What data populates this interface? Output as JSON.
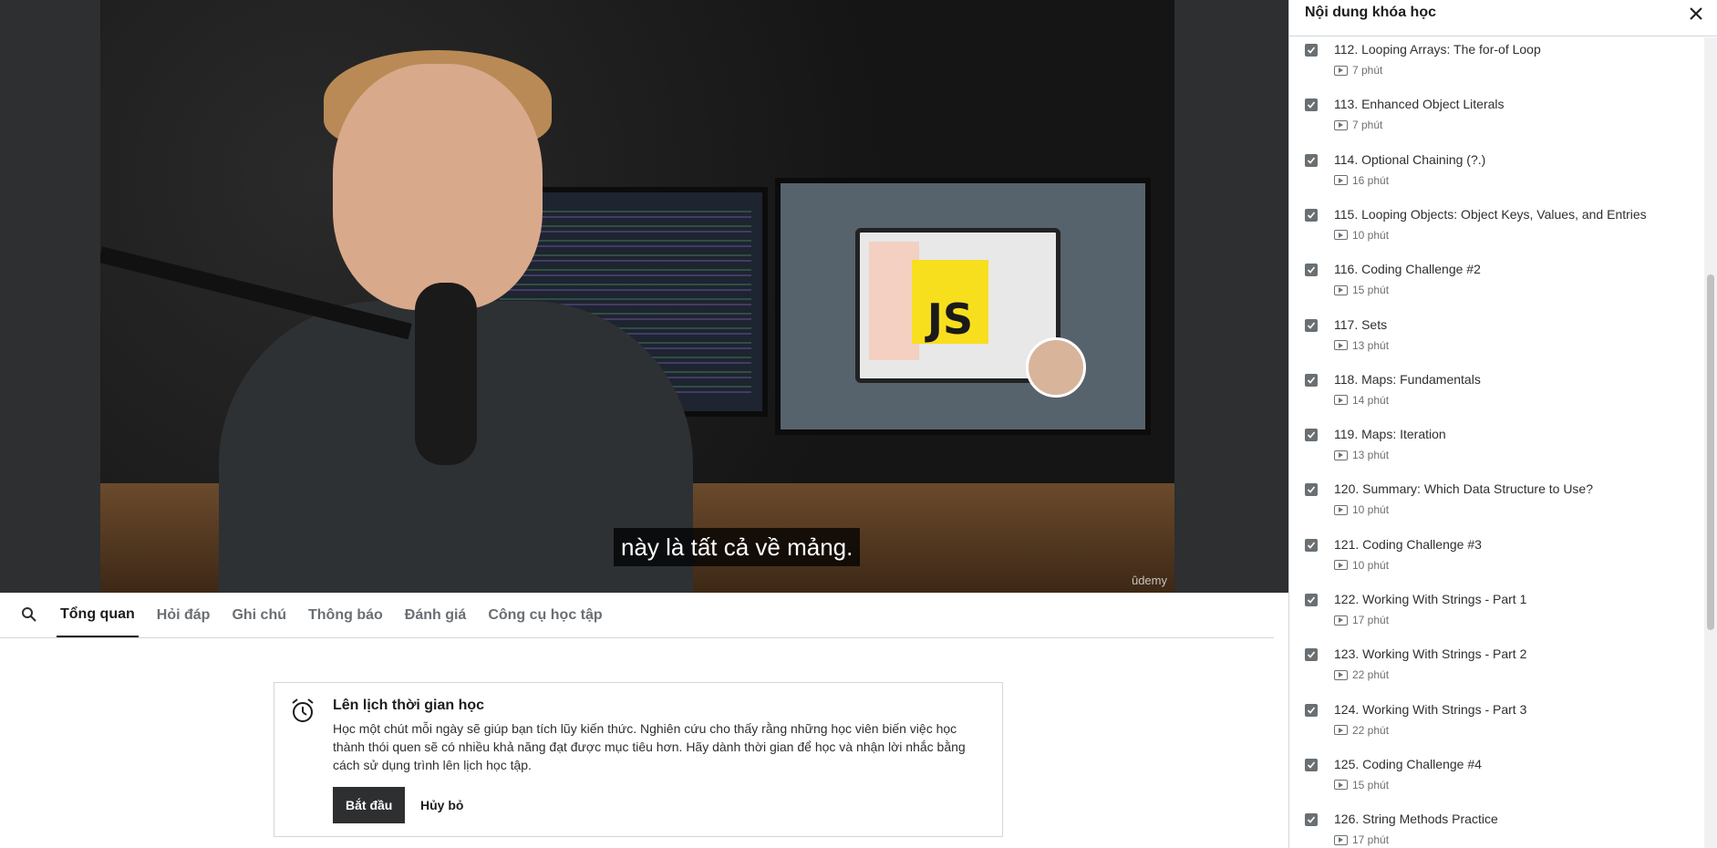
{
  "video": {
    "caption": "này là tất cả về mảng.",
    "watermark": "ûdemy",
    "sticker_text": "JS"
  },
  "tabs": [
    {
      "label": "Tổng quan",
      "active": true
    },
    {
      "label": "Hỏi đáp"
    },
    {
      "label": "Ghi chú"
    },
    {
      "label": "Thông báo"
    },
    {
      "label": "Đánh giá"
    },
    {
      "label": "Công cụ học tập"
    }
  ],
  "reminder": {
    "title": "Lên lịch thời gian học",
    "body": "Học một chút mỗi ngày sẽ giúp bạn tích lũy kiến thức. Nghiên cứu cho thấy rằng những học viên biến việc học thành thói quen sẽ có nhiều khả năng đạt được mục tiêu hơn. Hãy dành thời gian để học và nhận lời nhắc bằng cách sử dụng trình lên lịch học tập.",
    "start_label": "Bắt đầu",
    "cancel_label": "Hủy bỏ"
  },
  "sidebar": {
    "title": "Nội dung khóa học",
    "items": [
      {
        "label": "112. Looping Arrays: The for-of Loop",
        "duration": "7 phút",
        "done": true
      },
      {
        "label": "113. Enhanced Object Literals",
        "duration": "7 phút",
        "done": true
      },
      {
        "label": "114. Optional Chaining (?.)",
        "duration": "16 phút",
        "done": true
      },
      {
        "label": "115. Looping Objects: Object Keys, Values, and Entries",
        "duration": "10 phút",
        "done": true
      },
      {
        "label": "116. Coding Challenge #2",
        "duration": "15 phút",
        "done": true
      },
      {
        "label": "117. Sets",
        "duration": "13 phút",
        "done": true
      },
      {
        "label": "118. Maps: Fundamentals",
        "duration": "14 phút",
        "done": true
      },
      {
        "label": "119. Maps: Iteration",
        "duration": "13 phút",
        "done": true
      },
      {
        "label": "120. Summary: Which Data Structure to Use?",
        "duration": "10 phút",
        "done": true
      },
      {
        "label": "121. Coding Challenge #3",
        "duration": "10 phút",
        "done": true
      },
      {
        "label": "122. Working With Strings - Part 1",
        "duration": "17 phút",
        "done": true
      },
      {
        "label": "123. Working With Strings - Part 2",
        "duration": "22 phút",
        "done": true
      },
      {
        "label": "124. Working With Strings - Part 3",
        "duration": "22 phút",
        "done": true
      },
      {
        "label": "125. Coding Challenge #4",
        "duration": "15 phút",
        "done": true
      },
      {
        "label": "126. String Methods Practice",
        "duration": "17 phút",
        "done": true
      }
    ]
  }
}
